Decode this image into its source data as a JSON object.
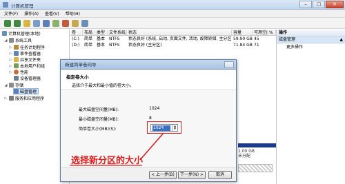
{
  "window": {
    "title": "计算机管理"
  },
  "menu": [
    "文件(F)",
    "操作(A)",
    "查看(V)",
    "帮助(H)"
  ],
  "tree": {
    "root": "计算机管理(本地)",
    "items": [
      {
        "label": "系统工具",
        "level": 1,
        "expanded": true
      },
      {
        "label": "任务计划程序",
        "level": 2
      },
      {
        "label": "事件查看器",
        "level": 2
      },
      {
        "label": "共享文件夹",
        "level": 2
      },
      {
        "label": "本地用户和组",
        "level": 2
      },
      {
        "label": "性能",
        "level": 2
      },
      {
        "label": "设备管理器",
        "level": 2
      },
      {
        "label": "存储",
        "level": 1,
        "expanded": true
      },
      {
        "label": "磁盘管理",
        "level": 2,
        "selected": true
      },
      {
        "label": "服务和应用程序",
        "level": 1
      }
    ]
  },
  "list": {
    "columns": [
      "卷",
      "布局",
      "类型",
      "文件系统",
      "状态",
      "容量",
      "可用空间",
      "%"
    ],
    "rows": [
      {
        "vol": "(C:)",
        "layout": "简单",
        "type": "基本",
        "fs": "NTFS",
        "status": "状态良好 (系统, 启动, 页面文件, 活动, 故障转储, 主分区)",
        "cap": "59.90 GB",
        "free": "45"
      },
      {
        "vol": "(D:)",
        "layout": "简单",
        "type": "基本",
        "fs": "NTFS",
        "status": "状态良好 (主分区)",
        "cap": "71.84 GB",
        "free": "71"
      }
    ]
  },
  "actions": {
    "header": "操作",
    "section": "磁盘管理",
    "more": "更多操作"
  },
  "disk": {
    "size": "1.00 GB",
    "status": "未分配"
  },
  "dialog": {
    "title": "新建简单卷向导",
    "heading": "指定卷大小",
    "subheading": "选择介于最大和最小值的卷大小。",
    "max_label": "最大磁盘空间量(MB):",
    "max_value": "1024",
    "min_label": "最小磁盘空间量(MB):",
    "min_value": "8",
    "size_label": "简单卷大小(MB)(S):",
    "size_value": "1024",
    "back": "< 上一步(B)",
    "next": "下一步(N) >",
    "cancel": "取消"
  },
  "annotation": "选择新分区的大小",
  "colors": {
    "annotation": "#e21c1c",
    "selection": "#3d6fc4"
  }
}
